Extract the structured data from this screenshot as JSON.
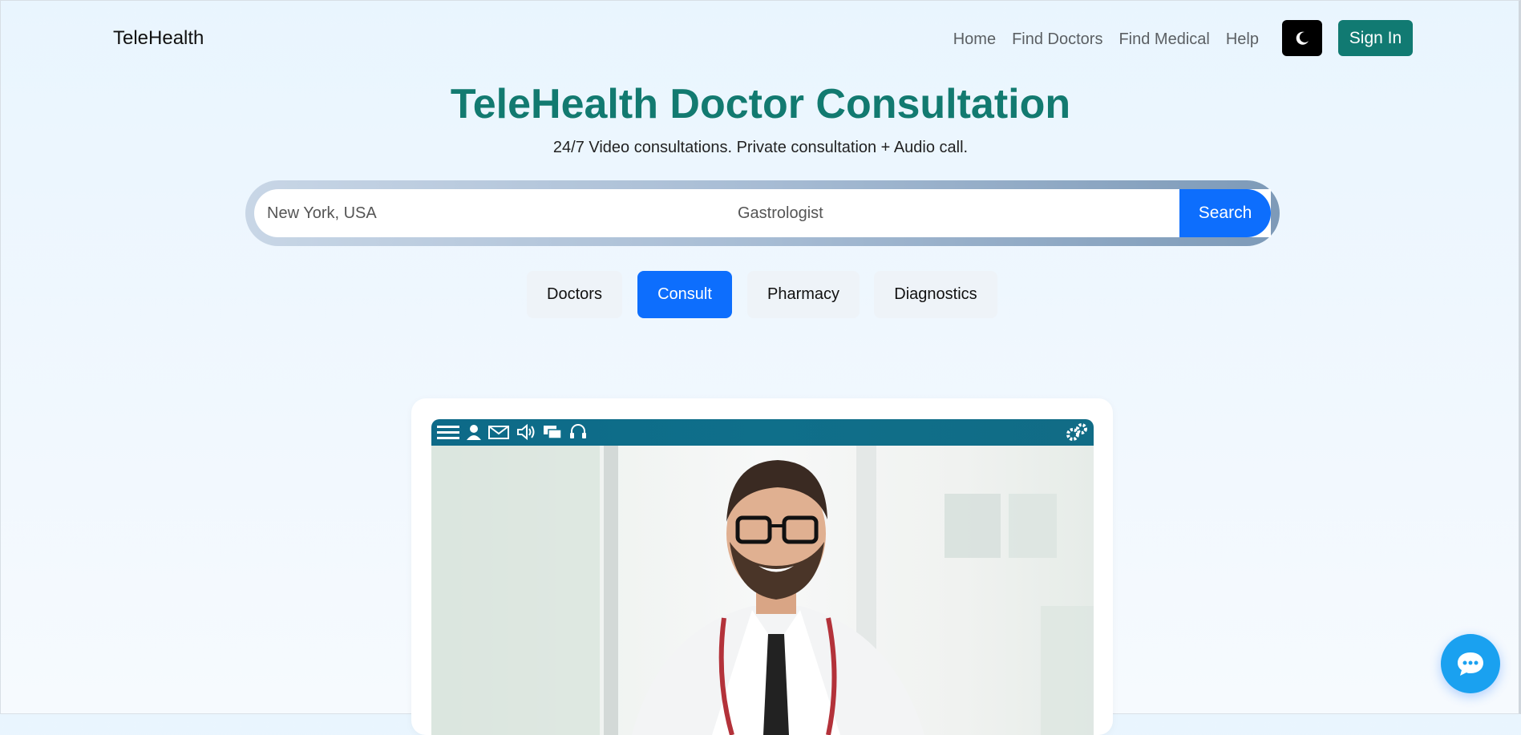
{
  "navbar": {
    "brand": "TeleHealth",
    "links": [
      "Home",
      "Find Doctors",
      "Find Medical",
      "Help"
    ],
    "theme_toggle_icon": "moon-icon",
    "signin_label": "Sign In"
  },
  "hero": {
    "title": "TeleHealth Doctor Consultation",
    "subtitle": "24/7 Video consultations. Private consultation + Audio call."
  },
  "search": {
    "location_value": "New York, USA",
    "specialty_value": "Gastrologist",
    "button_label": "Search"
  },
  "tabs": [
    {
      "label": "Doctors",
      "active": false
    },
    {
      "label": "Consult",
      "active": true
    },
    {
      "label": "Pharmacy",
      "active": false
    },
    {
      "label": "Diagnostics",
      "active": false
    }
  ],
  "video_card": {
    "toolbar_icons": [
      "menu-icon",
      "user-icon",
      "mail-icon",
      "speaker-icon",
      "chat-windows-icon",
      "headset-icon"
    ],
    "settings_icon": "gears-icon"
  },
  "chat_widget": {
    "icon": "chat-bubble-icon"
  },
  "colors": {
    "brand_teal": "#127a70",
    "primary_blue": "#0d6efd",
    "video_bar": "#0f6f8a"
  }
}
